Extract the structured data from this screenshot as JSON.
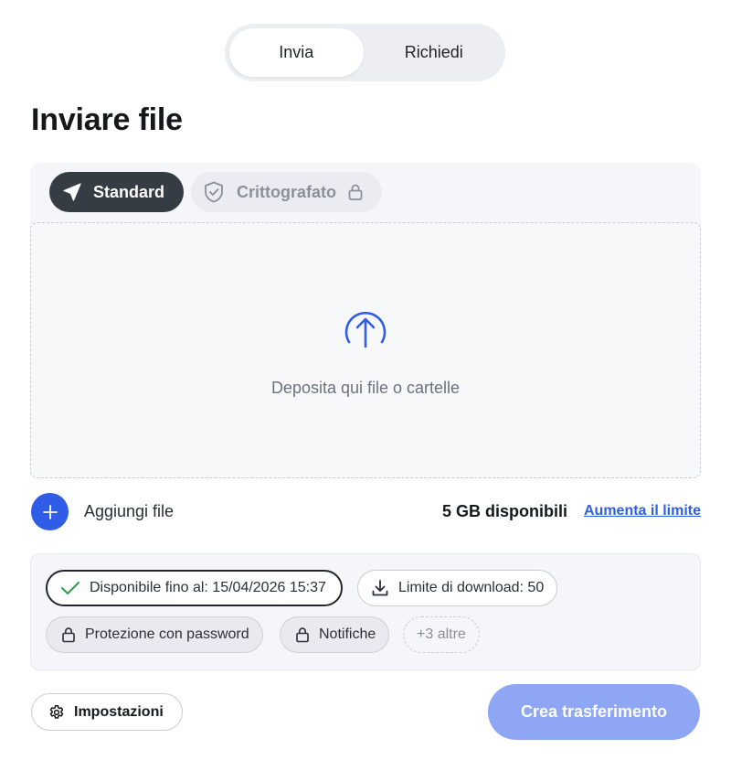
{
  "mode_toggle": {
    "tabs": [
      {
        "label": "Invia",
        "active": true
      },
      {
        "label": "Richiedi",
        "active": false
      }
    ]
  },
  "page": {
    "title": "Inviare file"
  },
  "transfer_type": {
    "standard_label": "Standard",
    "encrypted_label": "Crittografato",
    "standard_icon": "paper-plane-icon",
    "encrypted_icon": "shield-check-icon",
    "encrypted_lock_icon": "lock-icon"
  },
  "dropzone": {
    "label": "Deposita qui file o cartelle",
    "icon": "upload-arrow-icon"
  },
  "add_file": {
    "label": "Aggiungi file",
    "quota": "5 GB disponibili",
    "increase_link": "Aumenta il limite"
  },
  "options": {
    "expiry": "Disponibile fino al: 15/04/2026 15:37",
    "download_limit": "Limite di download: 50",
    "password": "Protezione con password",
    "notifications": "Notifiche",
    "more": "+3 altre"
  },
  "footer": {
    "settings_label": "Impostazioni",
    "create_label": "Crea trasferimento"
  },
  "colors": {
    "accent": "#2f5de8",
    "create_button": "#8ea6f3",
    "standard_pill": "#353c44"
  }
}
